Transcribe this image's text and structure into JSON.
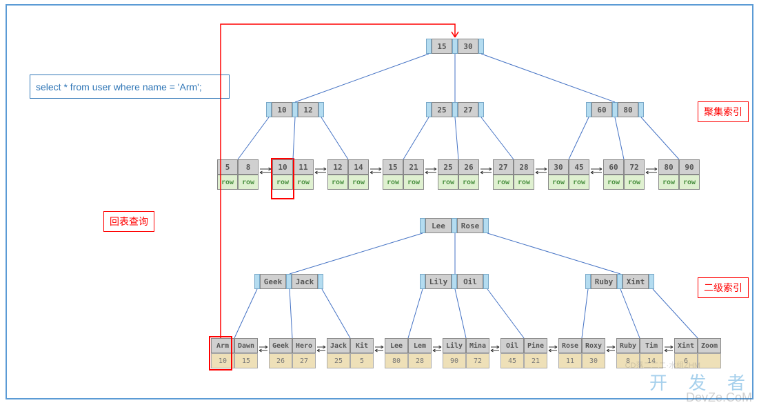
{
  "query": "select * from user where name = 'Arm';",
  "labels": {
    "callback": "回表查询",
    "clustered": "聚集索引",
    "secondary": "二级索引"
  },
  "watermark": "开 发 者",
  "watermark2": "DevZe.CoM",
  "cdn_text": "CD落二二二·水组ZHM",
  "chart_data": {
    "type": "tree-diagram",
    "clustered_index": {
      "root": [
        15,
        30
      ],
      "level2": [
        [
          10,
          12
        ],
        [
          25,
          27
        ],
        [
          60,
          80
        ]
      ],
      "leaves": [
        {
          "keys": [
            5,
            8
          ],
          "data": [
            "row",
            "row"
          ]
        },
        {
          "keys": [
            10,
            11
          ],
          "data": [
            "row",
            "row"
          ]
        },
        {
          "keys": [
            12,
            14
          ],
          "data": [
            "row",
            "row"
          ]
        },
        {
          "keys": [
            15,
            21
          ],
          "data": [
            "row",
            "row"
          ]
        },
        {
          "keys": [
            25,
            26
          ],
          "data": [
            "row",
            "row"
          ]
        },
        {
          "keys": [
            27,
            28
          ],
          "data": [
            "row",
            "row"
          ]
        },
        {
          "keys": [
            30,
            45
          ],
          "data": [
            "row",
            "row"
          ]
        },
        {
          "keys": [
            60,
            72
          ],
          "data": [
            "row",
            "row"
          ]
        },
        {
          "keys": [
            80,
            90
          ],
          "data": [
            "row",
            "row"
          ]
        }
      ]
    },
    "secondary_index": {
      "root": [
        "Lee",
        "Rose"
      ],
      "level2": [
        [
          "Geek",
          "Jack"
        ],
        [
          "Lily",
          "Oil"
        ],
        [
          "Ruby",
          "Xint"
        ]
      ],
      "leaves": [
        {
          "keys": [
            "Arm",
            "Dawn"
          ],
          "ids": [
            10,
            15
          ]
        },
        {
          "keys": [
            "Geek",
            "Hero"
          ],
          "ids": [
            26,
            27
          ]
        },
        {
          "keys": [
            "Jack",
            "Kit"
          ],
          "ids": [
            25,
            5
          ]
        },
        {
          "keys": [
            "Lee",
            "Lem"
          ],
          "ids": [
            80,
            28
          ]
        },
        {
          "keys": [
            "Lily",
            "Mina"
          ],
          "ids": [
            90,
            72
          ]
        },
        {
          "keys": [
            "Oil",
            "Pine"
          ],
          "ids": [
            45,
            21
          ]
        },
        {
          "keys": [
            "Rose",
            "Roxy"
          ],
          "ids": [
            11,
            30
          ]
        },
        {
          "keys": [
            "Ruby",
            "Tim"
          ],
          "ids": [
            8,
            14
          ]
        },
        {
          "keys": [
            "Xint",
            "Zoom"
          ],
          "ids": [
            6,
            ""
          ]
        }
      ]
    },
    "highlighted_path": {
      "secondary_leaf_key": "Arm",
      "clustered_leaf_key": 10
    }
  }
}
